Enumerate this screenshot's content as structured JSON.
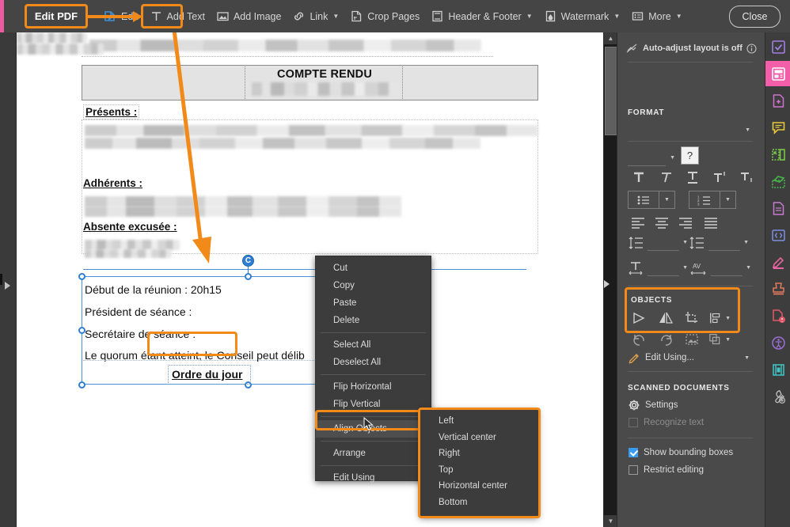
{
  "toolbar": {
    "edit_pdf_label": "Edit PDF",
    "items": [
      {
        "label": "Edit",
        "icon": "edit-pdf-icon",
        "caret": false
      },
      {
        "label": "Add Text",
        "icon": "text-icon",
        "caret": false
      },
      {
        "label": "Add Image",
        "icon": "image-icon",
        "caret": false
      },
      {
        "label": "Link",
        "icon": "link-icon",
        "caret": true
      },
      {
        "label": "Crop Pages",
        "icon": "crop-pages-icon",
        "caret": false
      },
      {
        "label": "Header & Footer",
        "icon": "header-footer-icon",
        "caret": true
      },
      {
        "label": "Watermark",
        "icon": "watermark-icon",
        "caret": true
      },
      {
        "label": "More",
        "icon": "more-icon",
        "caret": true
      }
    ],
    "close_label": "Close"
  },
  "document": {
    "title": "COMPTE RENDU",
    "sections": [
      {
        "label": "Présents :"
      },
      {
        "label": "Adhérents :"
      },
      {
        "label": "Absente excusée :"
      }
    ],
    "lines": [
      "Début de la réunion : 20h15",
      "Président de séance :",
      "Secrétaire de séance :",
      "Le quorum étant atteint, le Conseil peut délib"
    ],
    "agenda_heading": "Ordre du jour",
    "rotate_handle_label": "C"
  },
  "context_menu": {
    "items": [
      {
        "label": "Cut",
        "submenu": false,
        "sep_after": false
      },
      {
        "label": "Copy",
        "submenu": false,
        "sep_after": false
      },
      {
        "label": "Paste",
        "submenu": false,
        "sep_after": false
      },
      {
        "label": "Delete",
        "submenu": false,
        "sep_after": true
      },
      {
        "label": "Select All",
        "submenu": false,
        "sep_after": false
      },
      {
        "label": "Deselect All",
        "submenu": false,
        "sep_after": true
      },
      {
        "label": "Flip Horizontal",
        "submenu": false,
        "sep_after": false
      },
      {
        "label": "Flip Vertical",
        "submenu": false,
        "sep_after": true
      },
      {
        "label": "Align Objects",
        "submenu": true,
        "sep_after": true,
        "highlighted": true
      },
      {
        "label": "Arrange",
        "submenu": true,
        "sep_after": true
      },
      {
        "label": "Edit Using",
        "submenu": true,
        "sep_after": false
      }
    ],
    "submenu_items": [
      "Left",
      "Vertical center",
      "Right",
      "Top",
      "Horizontal center",
      "Bottom"
    ]
  },
  "right_panel": {
    "auto_adjust_text": "Auto-adjust layout is off",
    "format_heading": "FORMAT",
    "objects_heading": "OBJECTS",
    "edit_using_label": "Edit Using...",
    "scanned_heading": "SCANNED DOCUMENTS",
    "settings_label": "Settings",
    "recognize_label": "Recognize text",
    "bounding_label": "Show bounding boxes",
    "restrict_label": "Restrict editing",
    "bounding_checked": true,
    "restrict_checked": false,
    "recognize_checked": false,
    "text_style_buttons": [
      "bold-T-icon",
      "italic-T-icon",
      "underline-T-icon",
      "superscript-T-icon",
      "subscript-T-icon"
    ],
    "align_buttons": [
      "align-left-icon",
      "align-center-icon",
      "align-right-icon",
      "align-justify-icon"
    ],
    "object_buttons_row1": [
      "flip-horizontal-icon",
      "flip-vertical-icon",
      "crop-icon",
      "align-objects-icon"
    ],
    "object_buttons_row2": [
      "rotate-left-icon",
      "rotate-right-icon",
      "replace-image-icon",
      "arrange-icon"
    ]
  },
  "rail": {
    "icons": [
      {
        "name": "form-checkbox-icon",
        "color": "#a07fe0",
        "active": false
      },
      {
        "name": "page-layout-icon",
        "color": "#ffffff",
        "active": true
      },
      {
        "name": "add-page-icon",
        "color": "#d070d0",
        "active": false
      },
      {
        "name": "comment-icon",
        "color": "#e8c93a",
        "active": false
      },
      {
        "name": "organize-pages-icon",
        "color": "#7ccf4a",
        "active": false
      },
      {
        "name": "extract-page-icon",
        "color": "#49b84a",
        "active": false
      },
      {
        "name": "document-icon",
        "color": "#c77ad0",
        "active": false
      },
      {
        "name": "code-icon",
        "color": "#7d8fe0",
        "active": false
      },
      {
        "name": "highlighter-icon",
        "color": "#e8649e",
        "active": false
      },
      {
        "name": "stamp-icon",
        "color": "#e07a5f",
        "active": false
      },
      {
        "name": "protect-pdf-icon",
        "color": "#e2596a",
        "active": false
      },
      {
        "name": "accessibility-icon",
        "color": "#9a6fd6",
        "active": false
      },
      {
        "name": "media-icon",
        "color": "#3fc6c6",
        "active": false
      },
      {
        "name": "tools-icon",
        "color": "#b8b8b8",
        "active": false
      }
    ]
  },
  "colors": {
    "highlight": "#f28a19",
    "accent_blue": "#2e7fd4",
    "rail_active": "#f25fa8",
    "panel_bg": "#4a4a4a",
    "toolbar_bg": "#454545"
  }
}
